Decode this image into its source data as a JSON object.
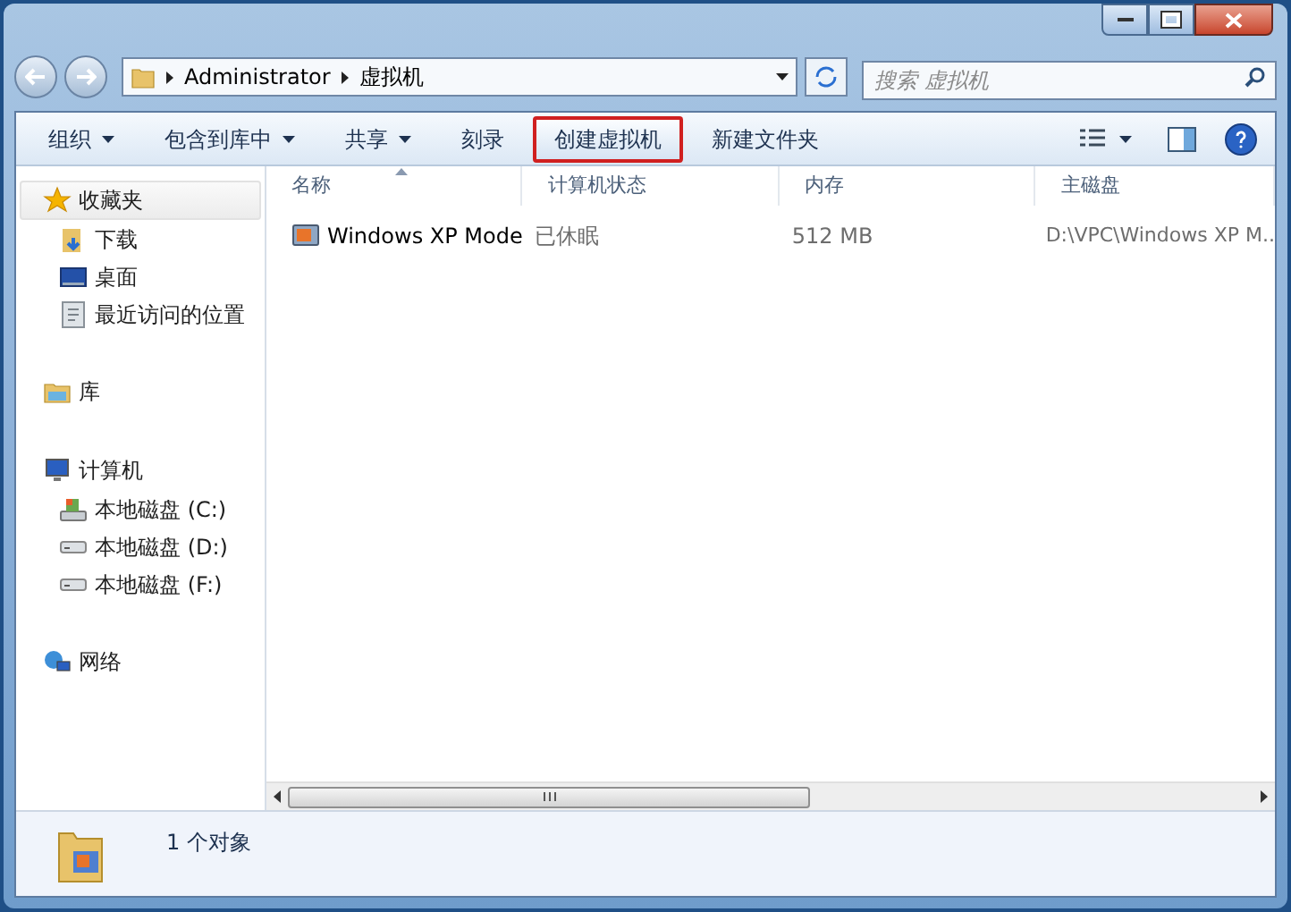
{
  "address_bar": {
    "path": [
      "Administrator",
      "虚拟机"
    ]
  },
  "search": {
    "placeholder": "搜索 虚拟机"
  },
  "toolbar": [
    {
      "label": "组织",
      "has_menu": true,
      "highlighted": false
    },
    {
      "label": "包含到库中",
      "has_menu": true,
      "highlighted": false
    },
    {
      "label": "共享",
      "has_menu": true,
      "highlighted": false
    },
    {
      "label": "刻录",
      "has_menu": false,
      "highlighted": false
    },
    {
      "label": "创建虚拟机",
      "has_menu": false,
      "highlighted": true
    },
    {
      "label": "新建文件夹",
      "has_menu": false,
      "highlighted": false
    }
  ],
  "sidebar": {
    "groups": [
      {
        "label": "收藏夹",
        "kind": "favorites",
        "selected": true,
        "children": [
          {
            "label": "下载",
            "kind": "downloads"
          },
          {
            "label": "桌面",
            "kind": "desktop"
          },
          {
            "label": "最近访问的位置",
            "kind": "recent"
          }
        ]
      },
      {
        "label": "库",
        "kind": "library",
        "selected": false
      },
      {
        "label": "计算机",
        "kind": "computer",
        "selected": false,
        "children": [
          {
            "label": "本地磁盘 (C:)",
            "kind": "system"
          },
          {
            "label": "本地磁盘 (D:)",
            "kind": "disk"
          },
          {
            "label": "本地磁盘 (F:)",
            "kind": "disk"
          }
        ]
      },
      {
        "label": "网络",
        "kind": "network",
        "selected": false
      }
    ]
  },
  "table": {
    "columns": [
      {
        "label": "名称",
        "sorted": true
      },
      {
        "label": "计算机状态",
        "sorted": false
      },
      {
        "label": "内存",
        "sorted": false
      },
      {
        "label": "主磁盘",
        "sorted": false
      }
    ],
    "rows": [
      [
        "Windows XP Mode",
        "已休眠",
        "512 MB",
        "D:\\VPC\\Windows XP M.."
      ]
    ]
  },
  "status_bar": {
    "text": "1 个对象"
  }
}
